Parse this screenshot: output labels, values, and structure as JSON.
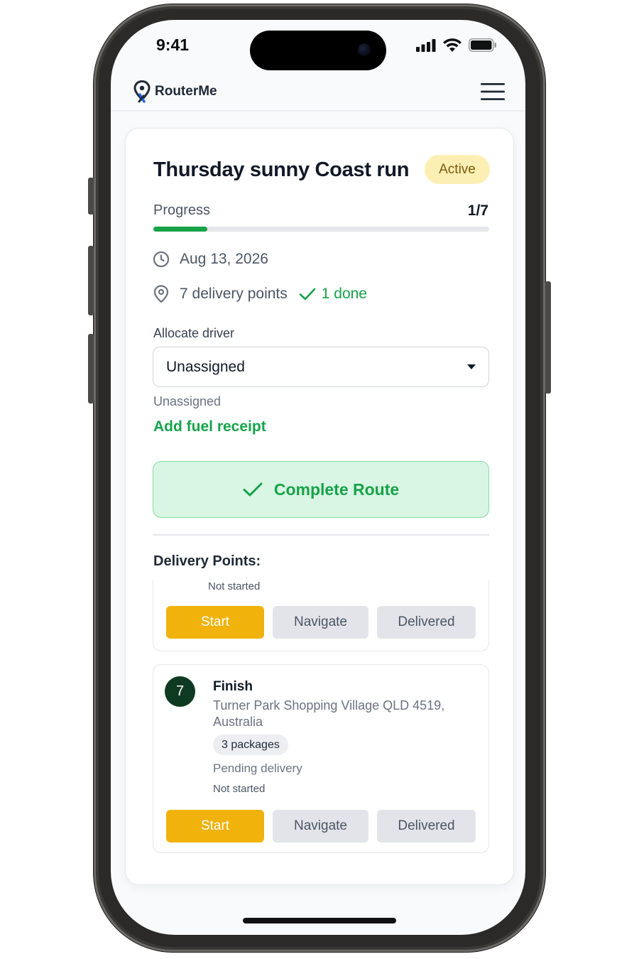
{
  "status_bar": {
    "time": "9:41"
  },
  "header": {
    "brand": "RouterMe",
    "menu_icon": "hamburger-menu-icon"
  },
  "route": {
    "title": "Thursday sunny Coast run",
    "status_badge": "Active",
    "progress_label": "Progress",
    "progress_count": "1/7",
    "progress_fraction": 0.16,
    "date": "Aug 13, 2026",
    "delivery_points": "7 delivery points",
    "done": "1 done"
  },
  "driver": {
    "label": "Allocate driver",
    "selected": "Unassigned",
    "helper": "Unassigned"
  },
  "actions": {
    "fuel_link": "Add fuel receipt",
    "complete": "Complete Route"
  },
  "delivery_section": {
    "title": "Delivery Points:",
    "points": [
      {
        "status": "Not started",
        "start": "Start",
        "navigate": "Navigate",
        "delivered": "Delivered"
      },
      {
        "number": "7",
        "name": "Finish",
        "address": "Turner Park Shopping Village QLD 4519, Australia",
        "packages": "3 packages",
        "delivery_state": "Pending delivery",
        "status": "Not started",
        "start": "Start",
        "navigate": "Navigate",
        "delivered": "Delivered"
      }
    ]
  },
  "colors": {
    "accent_green": "#16a34a",
    "badge_bg": "#fcefb4",
    "start_yellow": "#f0b20b",
    "number_badge": "#0f3a22"
  }
}
